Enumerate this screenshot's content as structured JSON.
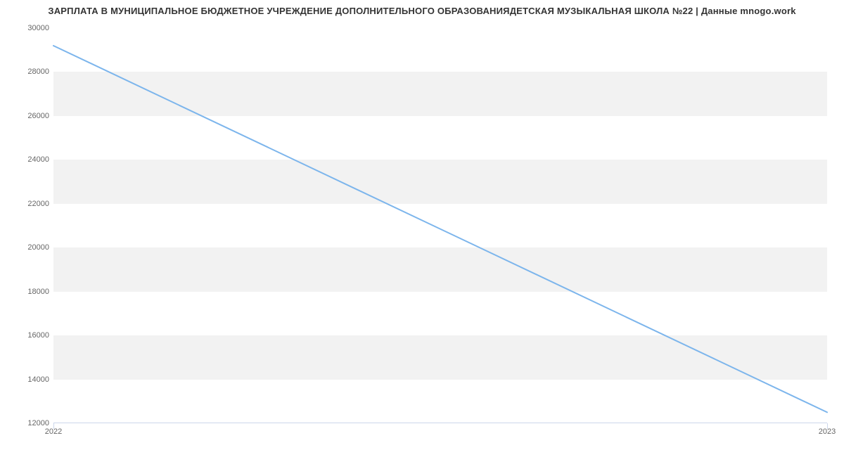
{
  "chart_data": {
    "type": "line",
    "title": "ЗАРПЛАТА В МУНИЦИПАЛЬНОЕ БЮДЖЕТНОЕ УЧРЕЖДЕНИЕ ДОПОЛНИТЕЛЬНОГО ОБРАЗОВАНИЯДЕТСКАЯ МУЗЫКАЛЬНАЯ ШКОЛА №22 | Данные mnogo.work",
    "xlabel": "",
    "ylabel": "",
    "ylim": [
      12000,
      30000
    ],
    "y_ticks": [
      12000,
      14000,
      16000,
      18000,
      20000,
      22000,
      24000,
      26000,
      28000,
      30000
    ],
    "x_ticks": [
      "2022",
      "2023"
    ],
    "categories": [
      "2022",
      "2023"
    ],
    "values": [
      29200,
      12500
    ],
    "line_color": "#7cb5ec"
  }
}
